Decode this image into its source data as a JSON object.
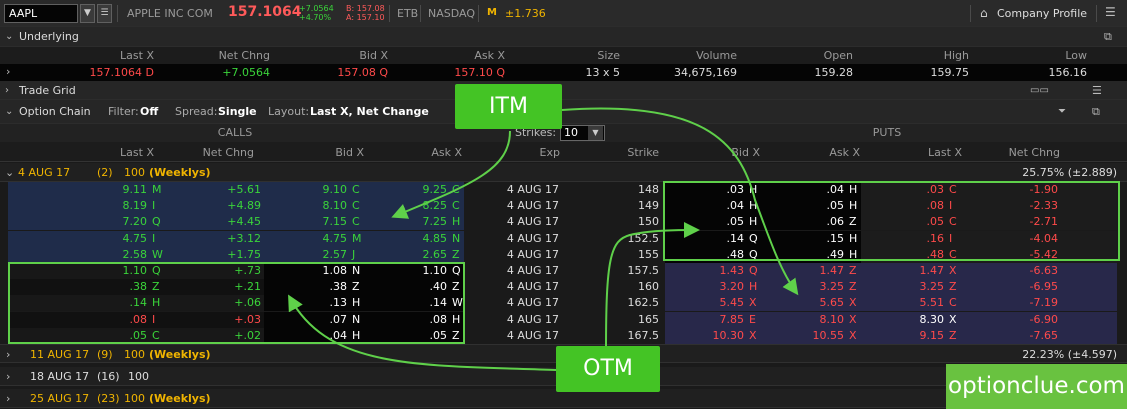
{
  "header": {
    "symbol": "AAPL",
    "company": "APPLE INC COM",
    "last": "157.1064",
    "change": "+7.0564",
    "change_pct": "+4.70%",
    "bid": "B: 157.08",
    "ask": "A: 157.10",
    "exchange1": "ETB",
    "exchange2": "NASDAQ",
    "volatility": "±1.736",
    "profile_btn": "Company Profile"
  },
  "underlying": {
    "title": "Underlying",
    "headers": [
      "Last X",
      "Net Chng",
      "Bid X",
      "Ask X",
      "Size",
      "Volume",
      "Open",
      "High",
      "Low"
    ],
    "values": [
      "157.1064 D",
      "+7.0564",
      "157.08 Q",
      "157.10 Q",
      "13 x 5",
      "34,675,169",
      "159.28",
      "159.75",
      "156.16"
    ]
  },
  "trade_grid": {
    "title": "Trade Grid"
  },
  "option_chain": {
    "title": "Option Chain",
    "filter_label": "Filter:",
    "filter_value": "Off",
    "spread_label": "Spread:",
    "spread_value": "Single",
    "layout_label": "Layout:",
    "layout_value": "Last X, Net Change",
    "calls_label": "CALLS",
    "puts_label": "PUTS",
    "strikes_label": "Strikes:",
    "strikes_value": "10",
    "calls_headers": [
      "Last X",
      "Net Chng",
      "Bid X",
      "Ask X"
    ],
    "mid_headers": [
      "Exp",
      "Strike"
    ],
    "puts_headers": [
      "Bid X",
      "Ask X",
      "Last X",
      "Net Chng"
    ]
  },
  "groups": [
    {
      "exp": "4 AUG 17",
      "count": "(2)",
      "mult": "100",
      "weekly": "(Weeklys)",
      "iv": "25.75% (±2.889)"
    },
    {
      "exp": "11 AUG 17",
      "count": "(9)",
      "mult": "100",
      "weekly": "(Weeklys)",
      "iv": "22.23% (±4.597)"
    },
    {
      "exp": "18 AUG 17",
      "count": "(16)",
      "mult": "100",
      "weekly": ""
    },
    {
      "exp": "25 AUG 17",
      "count": "(23)",
      "mult": "100",
      "weekly": "(Weeklys)"
    }
  ],
  "rows": [
    {
      "cl": "9.11",
      "cle": "M",
      "cn": "+5.61",
      "cb": "9.10",
      "cbe": "C",
      "ca": "9.25",
      "cae": "C",
      "exp": "4 AUG 17",
      "strike": "148",
      "pb": ".03",
      "pbe": "H",
      "pa": ".04",
      "pae": "H",
      "pl": ".03",
      "ple": "C",
      "pn": "-1.90"
    },
    {
      "cl": "8.19",
      "cle": "I",
      "cn": "+4.89",
      "cb": "8.10",
      "cbe": "C",
      "ca": "8.25",
      "cae": "C",
      "exp": "4 AUG 17",
      "strike": "149",
      "pb": ".04",
      "pbe": "H",
      "pa": ".05",
      "pae": "H",
      "pl": ".08",
      "ple": "I",
      "pn": "-2.33"
    },
    {
      "cl": "7.20",
      "cle": "Q",
      "cn": "+4.45",
      "cb": "7.15",
      "cbe": "C",
      "ca": "7.25",
      "cae": "H",
      "exp": "4 AUG 17",
      "strike": "150",
      "pb": ".05",
      "pbe": "H",
      "pa": ".06",
      "pae": "Z",
      "pl": ".05",
      "ple": "C",
      "pn": "-2.71"
    },
    {
      "cl": "4.75",
      "cle": "I",
      "cn": "+3.12",
      "cb": "4.75",
      "cbe": "M",
      "ca": "4.85",
      "cae": "N",
      "exp": "4 AUG 17",
      "strike": "152.5",
      "pb": ".14",
      "pbe": "Q",
      "pa": ".15",
      "pae": "H",
      "pl": ".16",
      "ple": "I",
      "pn": "-4.04"
    },
    {
      "cl": "2.58",
      "cle": "W",
      "cn": "+1.75",
      "cb": "2.57",
      "cbe": "J",
      "ca": "2.65",
      "cae": "Z",
      "exp": "4 AUG 17",
      "strike": "155",
      "pb": ".48",
      "pbe": "Q",
      "pa": ".49",
      "pae": "H",
      "pl": ".48",
      "ple": "C",
      "pn": "-5.42"
    },
    {
      "cl": "1.10",
      "cle": "Q",
      "cn": "+.73",
      "cb": "1.08",
      "cbe": "N",
      "ca": "1.10",
      "cae": "Q",
      "exp": "4 AUG 17",
      "strike": "157.5",
      "pb": "1.43",
      "pbe": "Q",
      "pa": "1.47",
      "pae": "Z",
      "pl": "1.47",
      "ple": "X",
      "pn": "-6.63"
    },
    {
      "cl": ".38",
      "cle": "Z",
      "cn": "+.21",
      "cb": ".38",
      "cbe": "Z",
      "ca": ".40",
      "cae": "Z",
      "exp": "4 AUG 17",
      "strike": "160",
      "pb": "3.20",
      "pbe": "H",
      "pa": "3.25",
      "pae": "Z",
      "pl": "3.25",
      "ple": "Z",
      "pn": "-6.95"
    },
    {
      "cl": ".14",
      "cle": "H",
      "cn": "+.06",
      "cb": ".13",
      "cbe": "H",
      "ca": ".14",
      "cae": "W",
      "exp": "4 AUG 17",
      "strike": "162.5",
      "pb": "5.45",
      "pbe": "X",
      "pa": "5.65",
      "pae": "X",
      "pl": "5.51",
      "ple": "C",
      "pn": "-7.19"
    },
    {
      "cl": ".08",
      "cle": "I",
      "cn": "+.03",
      "cb": ".07",
      "cbe": "N",
      "ca": ".08",
      "cae": "H",
      "exp": "4 AUG 17",
      "strike": "165",
      "pb": "7.85",
      "pbe": "E",
      "pa": "8.10",
      "pae": "X",
      "pl": "8.30",
      "ple": "X",
      "pn": "-6.90"
    },
    {
      "cl": ".05",
      "cle": "C",
      "cn": "+.02",
      "cb": ".04",
      "cbe": "H",
      "ca": ".05",
      "cae": "Z",
      "exp": "4 AUG 17",
      "strike": "167.5",
      "pb": "10.30",
      "pbe": "X",
      "pa": "10.55",
      "pae": "X",
      "pl": "9.15",
      "ple": "Z",
      "pn": "-7.65"
    }
  ],
  "callouts": {
    "itm": "ITM",
    "otm": "OTM"
  },
  "watermark": "optionclue.com",
  "colors": {
    "up": "#3ad43a",
    "down": "#ff4a4a",
    "itm_call_bg": "#1f2c4a",
    "itm_put_bg": "#1c1c1c",
    "otm_put_bg": "#28284a",
    "weekly": "#f0b400"
  }
}
